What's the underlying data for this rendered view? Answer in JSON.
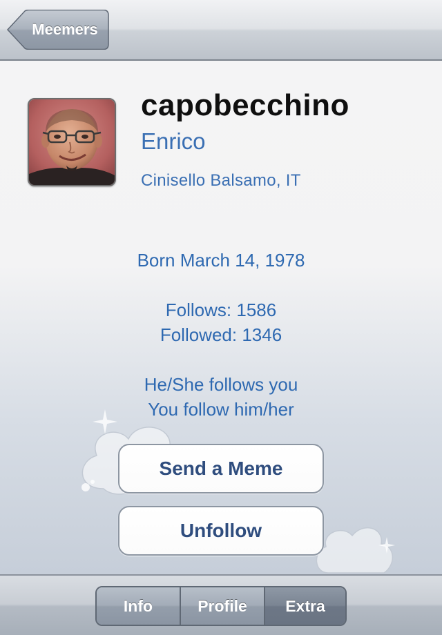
{
  "navbar": {
    "back_label": "Meemers"
  },
  "profile": {
    "username": "capobecchino",
    "real_name": "Enrico",
    "location": "Cinisello Balsamo, IT",
    "birth": "Born March 14, 1978",
    "follows": "Follows: 1586",
    "followed": "Followed: 1346",
    "relation_1": "He/She follows you",
    "relation_2": "You follow him/her"
  },
  "actions": {
    "send_meme": "Send a Meme",
    "unfollow": "Unfollow"
  },
  "toolbar": {
    "tabs": [
      {
        "label": "Info"
      },
      {
        "label": "Profile"
      },
      {
        "label": "Extra"
      }
    ],
    "selected": "Extra"
  },
  "colors": {
    "link_blue": "#3a6fb3",
    "button_text": "#2f4d7e"
  }
}
